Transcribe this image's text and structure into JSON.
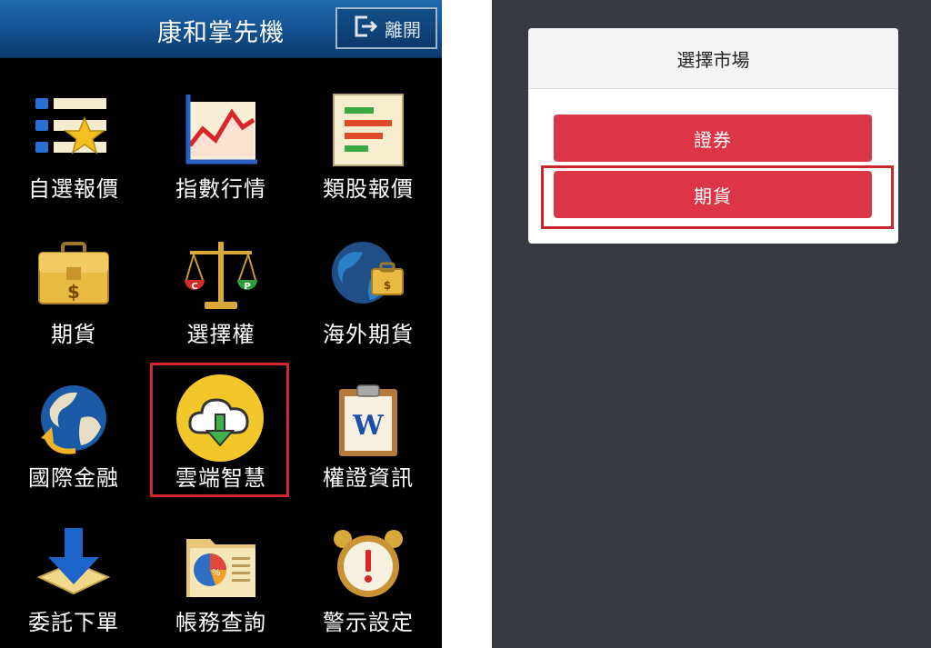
{
  "header": {
    "title": "康和掌先機",
    "exit_label": "離開"
  },
  "grid": [
    {
      "label": "自選報價",
      "icon": "watchlist-star-icon"
    },
    {
      "label": "指數行情",
      "icon": "index-chart-icon"
    },
    {
      "label": "類股報價",
      "icon": "sector-bars-icon"
    },
    {
      "label": "期貨",
      "icon": "briefcase-dollar-icon"
    },
    {
      "label": "選擇權",
      "icon": "scale-cp-icon"
    },
    {
      "label": "海外期貨",
      "icon": "globe-briefcase-icon"
    },
    {
      "label": "國際金融",
      "icon": "globe-arrow-icon"
    },
    {
      "label": "雲端智慧",
      "icon": "cloud-download-icon"
    },
    {
      "label": "權證資訊",
      "icon": "clipboard-w-icon"
    },
    {
      "label": "委託下單",
      "icon": "download-arrow-icon"
    },
    {
      "label": "帳務查詢",
      "icon": "folder-piechart-icon"
    },
    {
      "label": "警示設定",
      "icon": "alarm-clock-icon"
    }
  ],
  "modal": {
    "title": "選擇市場",
    "options": [
      "證券",
      "期貨"
    ]
  },
  "colors": {
    "header_blue": "#155596",
    "button_red": "#dc3545",
    "highlight_red": "#d3262c",
    "right_bg": "#373a40"
  }
}
